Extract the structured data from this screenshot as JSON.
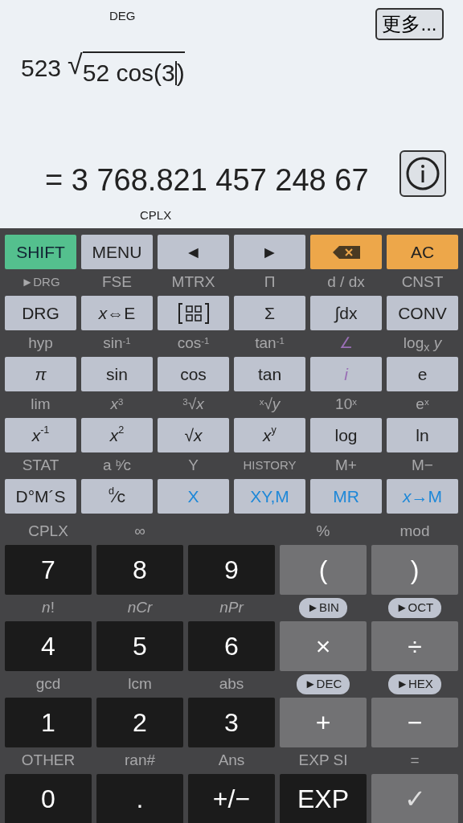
{
  "display": {
    "angle_mode": "DEG",
    "more_button": "更多...",
    "expression": {
      "prefix": "523",
      "radical": "√",
      "radicand_left": "52 cos(3",
      "radicand_right": ")"
    },
    "result": "= 3 768.821 457 248 67",
    "mode_label": "CPLX"
  },
  "sci_rows": [
    {
      "labels": [],
      "keys": [
        {
          "label": "SHIFT",
          "kind": "shift"
        },
        {
          "label": "MENU",
          "kind": "light"
        },
        {
          "label": "◄",
          "kind": "light"
        },
        {
          "label": "►",
          "kind": "light"
        },
        {
          "kind": "backspace"
        },
        {
          "label": "AC",
          "kind": "orange"
        }
      ]
    },
    {
      "labels": [
        {
          "text": "►DRG",
          "kind": "small"
        },
        {
          "text": "FSE",
          "kind": "plain"
        },
        {
          "text": "MTRX",
          "kind": "plain"
        },
        {
          "text": "Π",
          "kind": "plain"
        },
        {
          "text": "d / dx",
          "kind": "plain"
        },
        {
          "text": "CNST",
          "kind": "plain"
        }
      ],
      "keys": [
        {
          "label": "DRG",
          "kind": "light"
        },
        {
          "label": "*x*⇔E",
          "kind": "light"
        },
        {
          "kind": "matrix"
        },
        {
          "label": "Σ",
          "kind": "light"
        },
        {
          "label": "∫dx",
          "kind": "light"
        },
        {
          "label": "CONV",
          "kind": "light"
        }
      ]
    },
    {
      "labels": [
        {
          "text": "hyp",
          "kind": "plain"
        },
        {
          "text": "sin$^{-1}$",
          "kind": "plain"
        },
        {
          "text": "cos$^{-1}$",
          "kind": "plain"
        },
        {
          "text": "tan$^{-1}$",
          "kind": "plain"
        },
        {
          "text": "∠",
          "kind": "purple"
        },
        {
          "text": "log$_{x}$ *y*",
          "kind": "plain"
        }
      ],
      "keys": [
        {
          "label": "π",
          "kind": "constant"
        },
        {
          "label": "sin",
          "kind": "light"
        },
        {
          "label": "cos",
          "kind": "light"
        },
        {
          "label": "tan",
          "kind": "light"
        },
        {
          "label": "i",
          "kind": "imaginary"
        },
        {
          "label": "e",
          "kind": "light"
        }
      ]
    },
    {
      "labels": [
        {
          "text": "lim",
          "kind": "plain"
        },
        {
          "text": "*x*$^{3}$",
          "kind": "plain"
        },
        {
          "text": "$^{3}$√*x*",
          "kind": "plain"
        },
        {
          "text": "$^{x}$√*y*",
          "kind": "plain"
        },
        {
          "text": "10$^{x}$",
          "kind": "plain"
        },
        {
          "text": "e$^{x}$",
          "kind": "plain"
        }
      ],
      "keys": [
        {
          "label": "*x*$^{-1}$",
          "kind": "light"
        },
        {
          "label": "*x*$^{2}$",
          "kind": "light"
        },
        {
          "label": "√*x*",
          "kind": "light"
        },
        {
          "label": "*x*$^{y}$",
          "kind": "light"
        },
        {
          "label": "log",
          "kind": "light"
        },
        {
          "label": "ln",
          "kind": "light"
        }
      ]
    },
    {
      "labels": [
        {
          "text": "STAT",
          "kind": "plain"
        },
        {
          "text": "a $^{b}$⁄c",
          "kind": "plain"
        },
        {
          "text": "Y",
          "kind": "plain"
        },
        {
          "text": "HISTORY",
          "kind": "small"
        },
        {
          "text": "M+",
          "kind": "plain"
        },
        {
          "text": "M−",
          "kind": "plain"
        }
      ],
      "keys": [
        {
          "label": "D°M´S",
          "kind": "light"
        },
        {
          "label": "$^{d}$⁄c",
          "kind": "light"
        },
        {
          "label": "X",
          "kind": "memory"
        },
        {
          "label": "XY,M",
          "kind": "memory"
        },
        {
          "label": "MR",
          "kind": "memory"
        },
        {
          "label": "*x*→M",
          "kind": "memory"
        }
      ]
    }
  ],
  "num_rows": [
    {
      "labels": [
        {
          "text": "CPLX",
          "kind": "plain"
        },
        {
          "text": "∞",
          "kind": "plain"
        },
        {
          "kind": "none"
        },
        {
          "text": "%",
          "kind": "plain"
        },
        {
          "text": "mod",
          "kind": "plain"
        }
      ],
      "keys": [
        {
          "label": "7",
          "kind": "digit"
        },
        {
          "label": "8",
          "kind": "digit"
        },
        {
          "label": "9",
          "kind": "digit"
        },
        {
          "label": "(",
          "kind": "operator"
        },
        {
          "label": ")",
          "kind": "operator"
        }
      ]
    },
    {
      "labels": [
        {
          "text": "*n*!",
          "kind": "plain"
        },
        {
          "text": "nCr",
          "kind": "italic"
        },
        {
          "text": "nPr",
          "kind": "italic"
        },
        {
          "text": "►BIN",
          "kind": "pill"
        },
        {
          "text": "►OCT",
          "kind": "pill"
        }
      ],
      "keys": [
        {
          "label": "4",
          "kind": "digit"
        },
        {
          "label": "5",
          "kind": "digit"
        },
        {
          "label": "6",
          "kind": "digit"
        },
        {
          "label": "×",
          "kind": "operator"
        },
        {
          "label": "÷",
          "kind": "operator"
        }
      ]
    },
    {
      "labels": [
        {
          "text": "gcd",
          "kind": "plain"
        },
        {
          "text": "lcm",
          "kind": "plain"
        },
        {
          "text": "abs",
          "kind": "plain"
        },
        {
          "text": "►DEC",
          "kind": "pill"
        },
        {
          "text": "►HEX",
          "kind": "pill"
        }
      ],
      "keys": [
        {
          "label": "1",
          "kind": "digit"
        },
        {
          "label": "2",
          "kind": "digit"
        },
        {
          "label": "3",
          "kind": "digit"
        },
        {
          "label": "+",
          "kind": "operator"
        },
        {
          "label": "−",
          "kind": "operator"
        }
      ]
    },
    {
      "labels": [
        {
          "text": "OTHER",
          "kind": "plain"
        },
        {
          "text": "ran#",
          "kind": "plain"
        },
        {
          "text": "Ans",
          "kind": "plain"
        },
        {
          "text": "EXP SI",
          "kind": "plain"
        },
        {
          "text": "=",
          "kind": "plain"
        }
      ],
      "keys": [
        {
          "label": "0",
          "kind": "digit"
        },
        {
          "label": ".",
          "kind": "digit"
        },
        {
          "label": "+/−",
          "kind": "digit"
        },
        {
          "label": "EXP",
          "kind": "digit"
        },
        {
          "label": "✓",
          "kind": "equals"
        }
      ]
    }
  ]
}
